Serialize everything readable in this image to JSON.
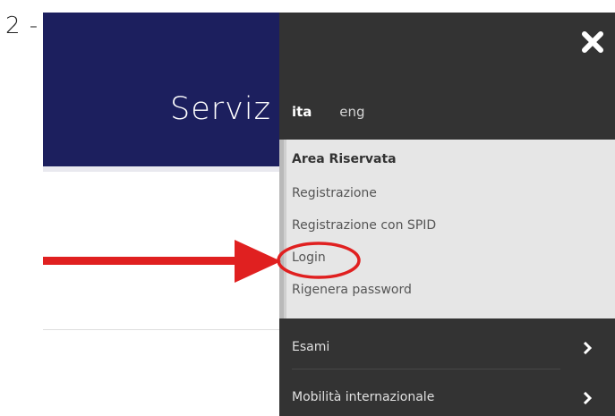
{
  "step": {
    "label": "2 -"
  },
  "header": {
    "title": "Serviz"
  },
  "menu": {
    "languages": [
      {
        "label": "ita",
        "active": true
      },
      {
        "label": "eng",
        "active": false
      }
    ],
    "area_riservata": {
      "title": "Area Riservata",
      "items": [
        {
          "label": "Registrazione"
        },
        {
          "label": "Registrazione con SPID"
        },
        {
          "label": "Login",
          "highlighted": true
        },
        {
          "label": "Rigenera password"
        }
      ]
    },
    "sections": [
      {
        "label": "Esami"
      },
      {
        "label": "Mobilità internazionale"
      }
    ],
    "close_icon": "close-x-icon",
    "chevron_icon": "chevron-right-icon"
  },
  "colors": {
    "header_bg": "#1c1f5e",
    "menu_bg": "#333333",
    "submenu_bg": "#e6e6e6",
    "annotation": "#e02020"
  }
}
